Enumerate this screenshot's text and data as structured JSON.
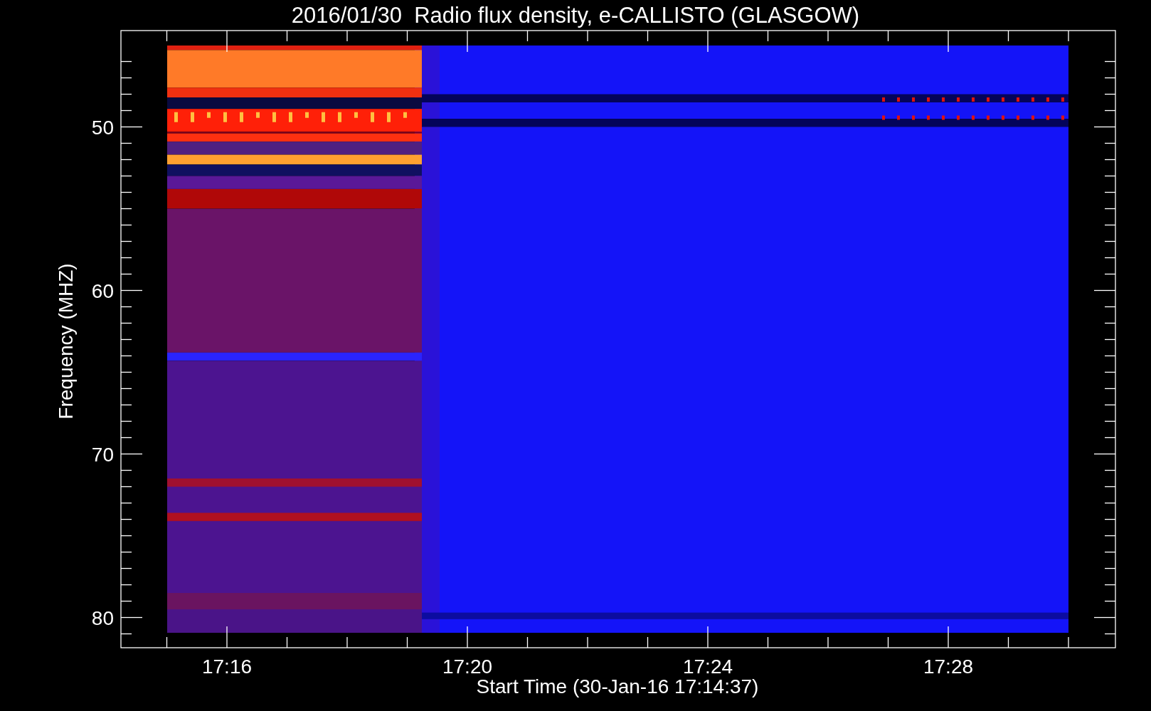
{
  "title": "2016/01/30  Radio flux density, e-CALLISTO (GLASGOW)",
  "y_axis": {
    "label": "Frequency (MHZ)",
    "ticks": [
      "50",
      "60",
      "70",
      "80"
    ]
  },
  "x_axis": {
    "label": "Start Time (30-Jan-16 17:14:37)",
    "ticks": [
      "17:16",
      "17:20",
      "17:24",
      "17:28"
    ]
  }
}
